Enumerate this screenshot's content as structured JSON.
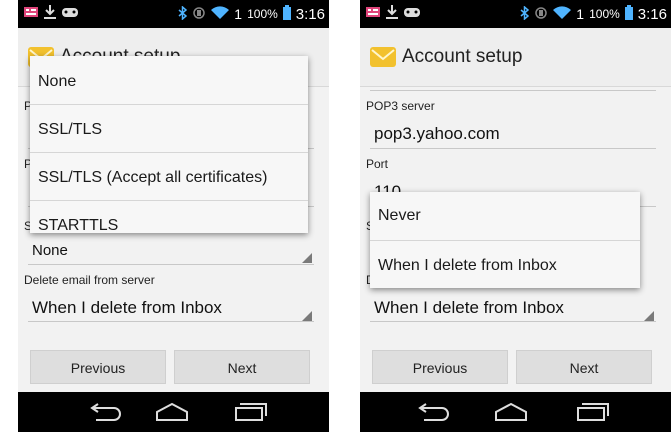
{
  "status_bar": {
    "battery_percent": "100%",
    "time": "3:16",
    "signal_badge": "1"
  },
  "action_bar": {
    "title": "Account setup"
  },
  "left": {
    "hint_labels": [
      "P",
      "P",
      "S"
    ],
    "security": {
      "value": "None"
    },
    "delete_label": "Delete email from server",
    "delete_value": "When I delete from Inbox",
    "menu": [
      "None",
      "SSL/TLS",
      "SSL/TLS (Accept all certificates)",
      "STARTTLS"
    ]
  },
  "right": {
    "pop3_label": "POP3 server",
    "pop3_value": "pop3.yahoo.com",
    "port_label": "Port",
    "port_value": "110",
    "hint_labels": [
      "S",
      "D"
    ],
    "delete_value": "When I delete from Inbox",
    "menu": [
      "Never",
      "When I delete from Inbox"
    ]
  },
  "buttons": {
    "previous": "Previous",
    "next": "Next"
  }
}
